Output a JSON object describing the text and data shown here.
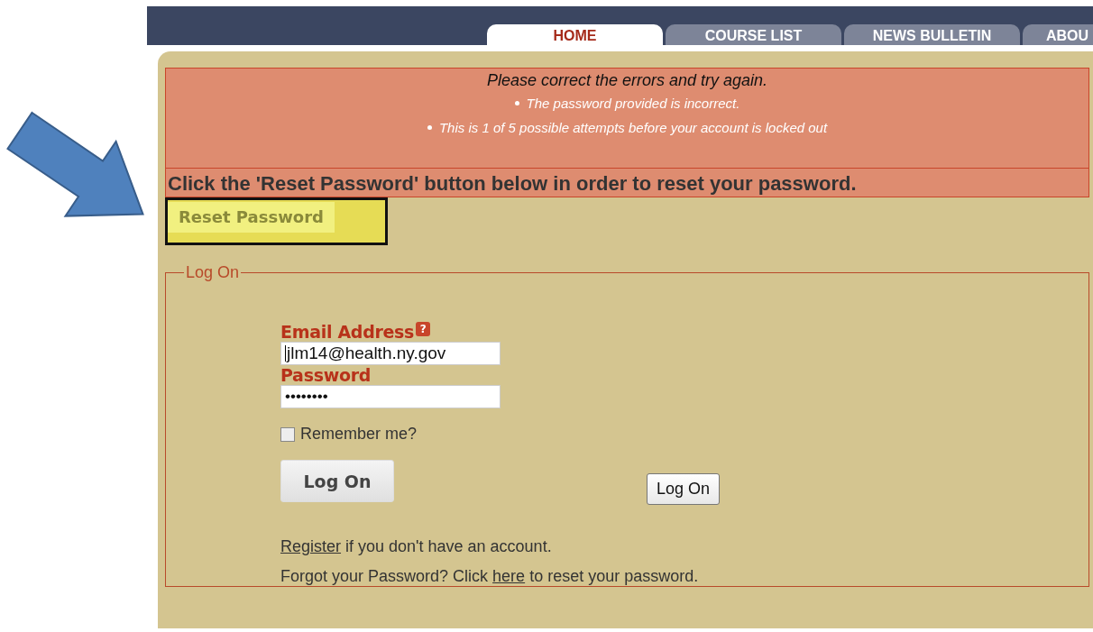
{
  "tabs": [
    {
      "label": "HOME",
      "selected": true
    },
    {
      "label": "COURSE LIST",
      "selected": false
    },
    {
      "label": "NEWS BULLETIN",
      "selected": false
    },
    {
      "label": "ABOU",
      "selected": false
    }
  ],
  "error": {
    "title": "Please correct the errors and try again.",
    "items": [
      "The password provided is incorrect.",
      "This is 1 of 5 possible attempts before your account is locked out"
    ]
  },
  "instruction": "Click the 'Reset Password' button below in order to reset your password.",
  "reset_button": {
    "label": "Reset Password",
    "highlighted": true
  },
  "logon": {
    "legend": "Log On",
    "email": {
      "label": "Email Address",
      "help": "?",
      "value": "jlm14@health.ny.gov"
    },
    "password": {
      "label": "Password",
      "value": "••••••••"
    },
    "remember": {
      "label": "Remember me?",
      "checked": false
    },
    "buttons": [
      "Log On",
      "Log On"
    ],
    "register_line": {
      "link": "Register",
      "after": " if you don't have an account."
    },
    "forgot_line": {
      "before": "Forgot your Password? Click ",
      "link": "here",
      "after": " to reset your password."
    }
  }
}
